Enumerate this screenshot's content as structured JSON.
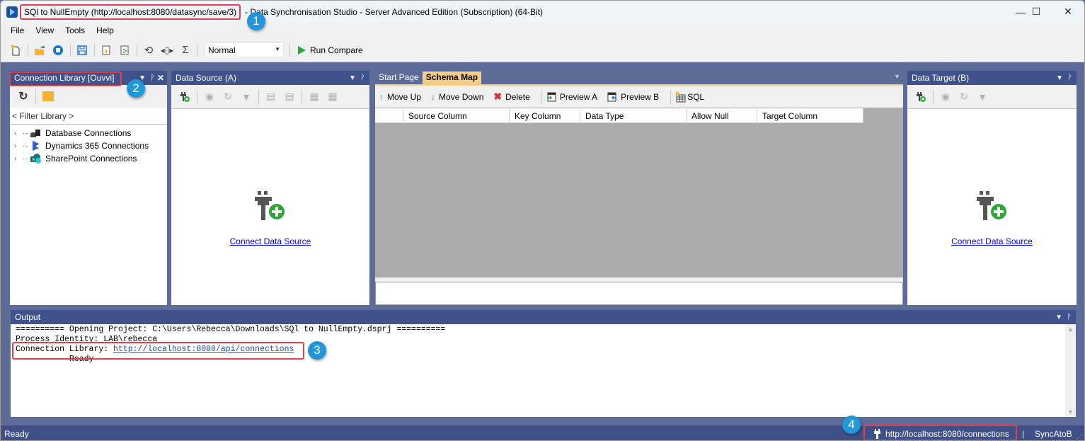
{
  "window": {
    "title_highlight": "SQl to NullEmpty (http://localhost:8080/datasync/save/3)",
    "title_rest": "- Data Synchronisation Studio - Server Advanced Edition (Subscription) (64-Bit)",
    "controls": {
      "minimize": "—",
      "maximize": "☐",
      "close": "✕"
    }
  },
  "menu": [
    "File",
    "View",
    "Tools",
    "Help"
  ],
  "toolbar": {
    "buttons": [
      "new-project",
      "open-project",
      "stop",
      "save",
      "import",
      "export",
      "sync",
      "compare-columns",
      "sum"
    ],
    "mode_value": "Normal",
    "run_label": "Run Compare"
  },
  "connection_library": {
    "title": "Connection Library [Ouvvi]",
    "filter_placeholder": "< Filter Library >",
    "items": [
      {
        "label": "Database Connections",
        "icon": "database-icon"
      },
      {
        "label": "Dynamics 365 Connections",
        "icon": "dynamics-icon"
      },
      {
        "label": "SharePoint Connections",
        "icon": "sharepoint-icon"
      }
    ]
  },
  "data_source": {
    "title": "Data Source (A)",
    "connect_link": "Connect Data Source"
  },
  "data_target": {
    "title": "Data Target (B)",
    "connect_link": "Connect Data Source"
  },
  "document_tabs": [
    {
      "label": "Start Page",
      "active": false
    },
    {
      "label": "Schema Map",
      "active": true
    }
  ],
  "schema_toolbar": {
    "move_up": "Move Up",
    "move_down": "Move Down",
    "delete": "Delete",
    "preview_a": "Preview A",
    "preview_b": "Preview B",
    "sql": "SQL"
  },
  "schema_grid": {
    "columns": [
      "",
      "Source Column",
      "Key Column",
      "Data Type",
      "Allow Null",
      "Target Column"
    ]
  },
  "output": {
    "title": "Output",
    "lines": [
      "========== Opening Project: C:\\Users\\Rebecca\\Downloads\\SQl to NullEmpty.dsprj ==========",
      "Process Identity: LAB\\rebecca"
    ],
    "library_prefix": "Connection Library: ",
    "library_url": "http://localhost:8080/api/connections",
    "ready_line": "---------- Ready ----------"
  },
  "status": {
    "left": "Ready",
    "connection_url": "http://localhost:8080/connections",
    "separator": "|",
    "mode": "SyncAtoB"
  },
  "annotations": [
    "1",
    "2",
    "3",
    "4"
  ],
  "colors": {
    "panel_header": "#3f528b",
    "workspace": "#5d6b98",
    "active_tab": "#f5cc84",
    "highlight": "#e0404a",
    "badge": "#2196d8",
    "link": "#0000ee"
  }
}
